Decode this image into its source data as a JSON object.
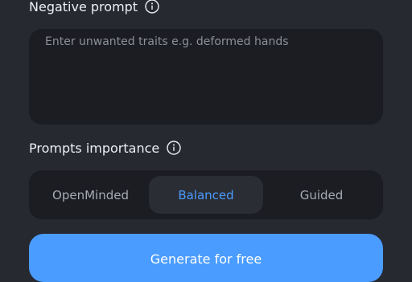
{
  "negative_prompt": {
    "title": "Negative prompt",
    "info_icon": "info-icon",
    "placeholder": "Enter unwanted traits e.g. deformed hands",
    "value": ""
  },
  "prompts_importance": {
    "title": "Prompts importance",
    "info_icon": "info-icon",
    "options": [
      "OpenMinded",
      "Balanced",
      "Guided"
    ],
    "selected": "Balanced"
  },
  "generate_button": {
    "label": "Generate for free"
  },
  "colors": {
    "background": "#262930",
    "panel": "#1b1d22",
    "accent": "#4a9cff",
    "selected_segment": "#2a2d34"
  }
}
